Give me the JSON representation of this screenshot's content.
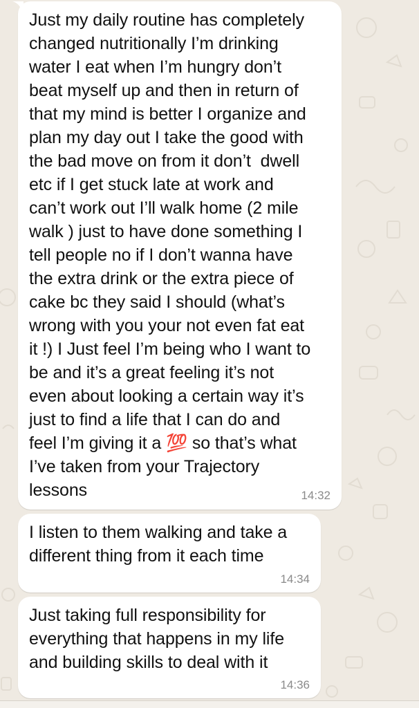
{
  "colors": {
    "wallpaper": "#efeae2",
    "bubble": "#ffffff",
    "text": "#111111",
    "timestamp": "#8a8a8a"
  },
  "messages": [
    {
      "direction": "incoming",
      "lines": [
        "Just my daily routine has completely",
        "changed nutritionally I’m drinking",
        "water I eat when I’m hungry don’t",
        "beat myself up and then in return of",
        "that my mind is better I organize and",
        "plan my day out I take the good with",
        "the bad move on from it don’t  dwell",
        "etc if I get stuck late at work and",
        "can’t work out I’ll walk home (2 mile",
        "walk ) just to have done something I",
        "tell people no if I don’t wanna have",
        "the extra drink or the extra piece of",
        "cake bc they said I should (what’s",
        "wrong with you your not even fat eat",
        "it !) I Just feel I’m being who I want to",
        "be and it’s a great feeling it’s not",
        "even about looking a certain way it’s",
        "just to find a life that I can do and",
        "feel I’m giving it a 💯 so that’s what",
        "I’ve taken from your Trajectory",
        "lessons"
      ],
      "time": "14:32"
    },
    {
      "direction": "incoming",
      "lines": [
        "I listen to them walking and take a",
        "different thing from it each time"
      ],
      "time": "14:34"
    },
    {
      "direction": "incoming",
      "lines": [
        "Just taking full responsibility for",
        "everything that happens in my life",
        "and building skills to deal with it"
      ],
      "time": "14:36"
    }
  ]
}
